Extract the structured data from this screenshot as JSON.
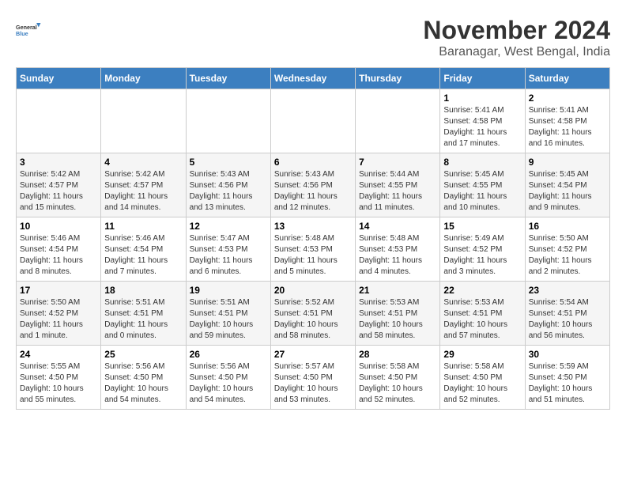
{
  "header": {
    "logo_line1": "General",
    "logo_line2": "Blue",
    "month": "November 2024",
    "location": "Baranagar, West Bengal, India"
  },
  "weekdays": [
    "Sunday",
    "Monday",
    "Tuesday",
    "Wednesday",
    "Thursday",
    "Friday",
    "Saturday"
  ],
  "weeks": [
    [
      {
        "day": "",
        "info": ""
      },
      {
        "day": "",
        "info": ""
      },
      {
        "day": "",
        "info": ""
      },
      {
        "day": "",
        "info": ""
      },
      {
        "day": "",
        "info": ""
      },
      {
        "day": "1",
        "info": "Sunrise: 5:41 AM\nSunset: 4:58 PM\nDaylight: 11 hours and 17 minutes."
      },
      {
        "day": "2",
        "info": "Sunrise: 5:41 AM\nSunset: 4:58 PM\nDaylight: 11 hours and 16 minutes."
      }
    ],
    [
      {
        "day": "3",
        "info": "Sunrise: 5:42 AM\nSunset: 4:57 PM\nDaylight: 11 hours and 15 minutes."
      },
      {
        "day": "4",
        "info": "Sunrise: 5:42 AM\nSunset: 4:57 PM\nDaylight: 11 hours and 14 minutes."
      },
      {
        "day": "5",
        "info": "Sunrise: 5:43 AM\nSunset: 4:56 PM\nDaylight: 11 hours and 13 minutes."
      },
      {
        "day": "6",
        "info": "Sunrise: 5:43 AM\nSunset: 4:56 PM\nDaylight: 11 hours and 12 minutes."
      },
      {
        "day": "7",
        "info": "Sunrise: 5:44 AM\nSunset: 4:55 PM\nDaylight: 11 hours and 11 minutes."
      },
      {
        "day": "8",
        "info": "Sunrise: 5:45 AM\nSunset: 4:55 PM\nDaylight: 11 hours and 10 minutes."
      },
      {
        "day": "9",
        "info": "Sunrise: 5:45 AM\nSunset: 4:54 PM\nDaylight: 11 hours and 9 minutes."
      }
    ],
    [
      {
        "day": "10",
        "info": "Sunrise: 5:46 AM\nSunset: 4:54 PM\nDaylight: 11 hours and 8 minutes."
      },
      {
        "day": "11",
        "info": "Sunrise: 5:46 AM\nSunset: 4:54 PM\nDaylight: 11 hours and 7 minutes."
      },
      {
        "day": "12",
        "info": "Sunrise: 5:47 AM\nSunset: 4:53 PM\nDaylight: 11 hours and 6 minutes."
      },
      {
        "day": "13",
        "info": "Sunrise: 5:48 AM\nSunset: 4:53 PM\nDaylight: 11 hours and 5 minutes."
      },
      {
        "day": "14",
        "info": "Sunrise: 5:48 AM\nSunset: 4:53 PM\nDaylight: 11 hours and 4 minutes."
      },
      {
        "day": "15",
        "info": "Sunrise: 5:49 AM\nSunset: 4:52 PM\nDaylight: 11 hours and 3 minutes."
      },
      {
        "day": "16",
        "info": "Sunrise: 5:50 AM\nSunset: 4:52 PM\nDaylight: 11 hours and 2 minutes."
      }
    ],
    [
      {
        "day": "17",
        "info": "Sunrise: 5:50 AM\nSunset: 4:52 PM\nDaylight: 11 hours and 1 minute."
      },
      {
        "day": "18",
        "info": "Sunrise: 5:51 AM\nSunset: 4:51 PM\nDaylight: 11 hours and 0 minutes."
      },
      {
        "day": "19",
        "info": "Sunrise: 5:51 AM\nSunset: 4:51 PM\nDaylight: 10 hours and 59 minutes."
      },
      {
        "day": "20",
        "info": "Sunrise: 5:52 AM\nSunset: 4:51 PM\nDaylight: 10 hours and 58 minutes."
      },
      {
        "day": "21",
        "info": "Sunrise: 5:53 AM\nSunset: 4:51 PM\nDaylight: 10 hours and 58 minutes."
      },
      {
        "day": "22",
        "info": "Sunrise: 5:53 AM\nSunset: 4:51 PM\nDaylight: 10 hours and 57 minutes."
      },
      {
        "day": "23",
        "info": "Sunrise: 5:54 AM\nSunset: 4:51 PM\nDaylight: 10 hours and 56 minutes."
      }
    ],
    [
      {
        "day": "24",
        "info": "Sunrise: 5:55 AM\nSunset: 4:50 PM\nDaylight: 10 hours and 55 minutes."
      },
      {
        "day": "25",
        "info": "Sunrise: 5:56 AM\nSunset: 4:50 PM\nDaylight: 10 hours and 54 minutes."
      },
      {
        "day": "26",
        "info": "Sunrise: 5:56 AM\nSunset: 4:50 PM\nDaylight: 10 hours and 54 minutes."
      },
      {
        "day": "27",
        "info": "Sunrise: 5:57 AM\nSunset: 4:50 PM\nDaylight: 10 hours and 53 minutes."
      },
      {
        "day": "28",
        "info": "Sunrise: 5:58 AM\nSunset: 4:50 PM\nDaylight: 10 hours and 52 minutes."
      },
      {
        "day": "29",
        "info": "Sunrise: 5:58 AM\nSunset: 4:50 PM\nDaylight: 10 hours and 52 minutes."
      },
      {
        "day": "30",
        "info": "Sunrise: 5:59 AM\nSunset: 4:50 PM\nDaylight: 10 hours and 51 minutes."
      }
    ]
  ]
}
